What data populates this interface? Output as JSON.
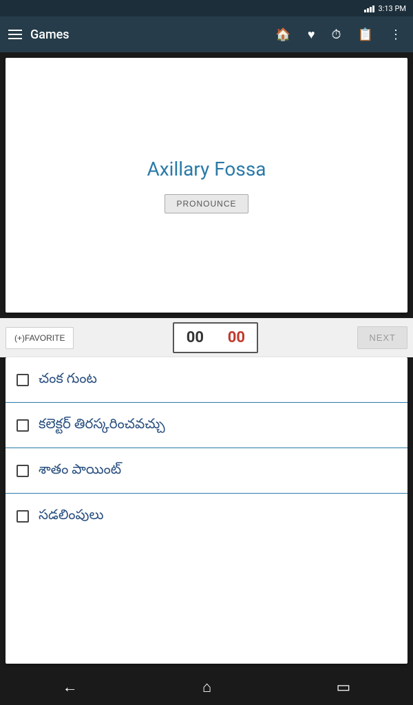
{
  "statusBar": {
    "time": "3:13 PM"
  },
  "appBar": {
    "title": "Games",
    "homeIcon": "🏠",
    "heartIcon": "♥",
    "historyIcon": "⏱",
    "clipboardIcon": "📋",
    "moreIcon": "⋮"
  },
  "mainCard": {
    "wordTitle": "Axillary Fossa",
    "pronounceLabel": "PRONOUNCE"
  },
  "actionBar": {
    "favoriteLabel": "(+)FAVORITE",
    "scoreLeft": "00",
    "scoreRight": "00",
    "nextLabel": "NEXT"
  },
  "quizOptions": [
    {
      "id": 1,
      "text": "చంక గుంట"
    },
    {
      "id": 2,
      "text": "కలెక్టర్ తిరస్కరించవచ్చు"
    },
    {
      "id": 3,
      "text": "శాతం పాయింట్"
    },
    {
      "id": 4,
      "text": "సడలింపులు"
    }
  ],
  "navBar": {
    "backIcon": "←",
    "homeIcon": "⌂",
    "recentIcon": "▭"
  }
}
